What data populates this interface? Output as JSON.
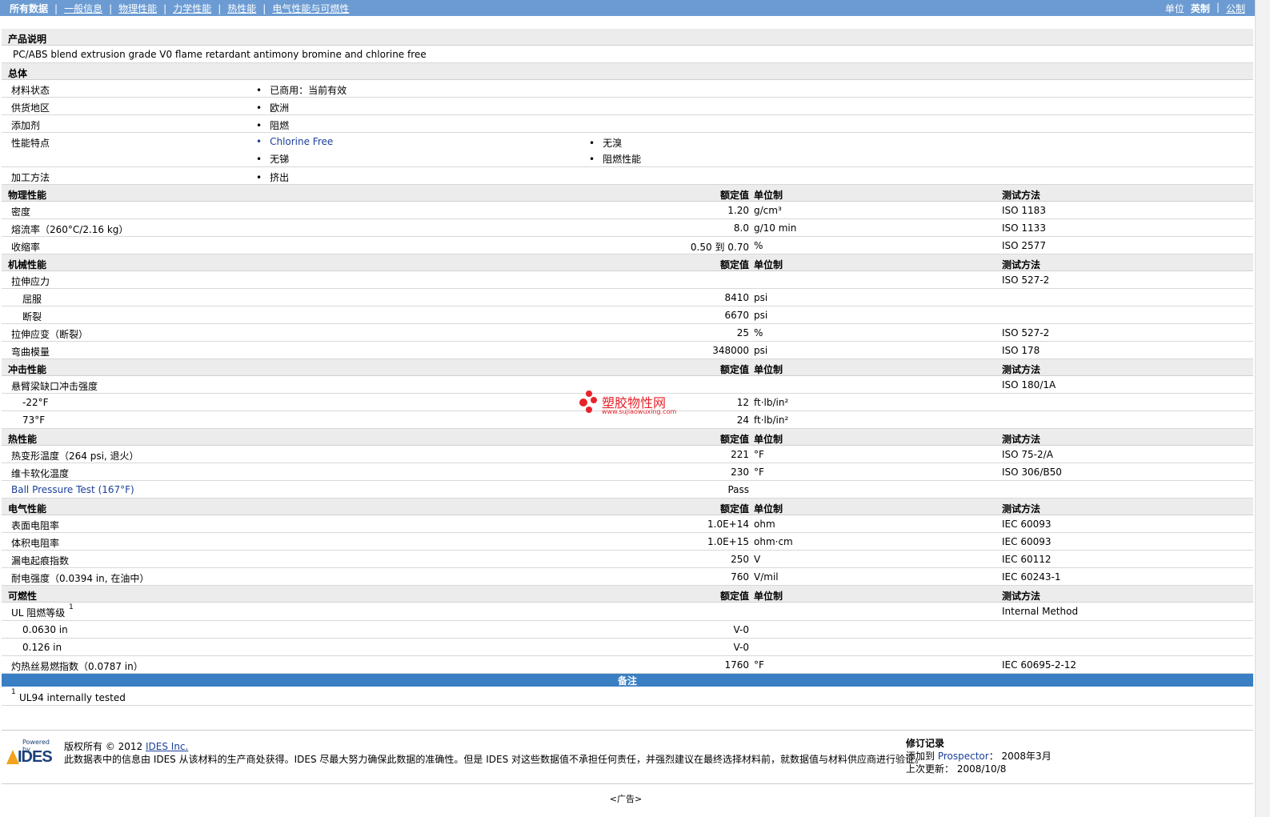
{
  "nav": {
    "items": [
      "所有数据",
      "一般信息",
      "物理性能",
      "力学性能",
      "热性能",
      "电气性能与可燃性"
    ],
    "units_label": "单位",
    "english": "英制",
    "metric": "公制"
  },
  "description": {
    "header": "产品说明",
    "text": "PC/ABS blend extrusion grade V0 flame retardant antimony bromine and chlorine free"
  },
  "general": {
    "header": "总体",
    "rows": [
      {
        "name": "材料状态",
        "items": [
          "已商用：当前有效"
        ]
      },
      {
        "name": "供货地区",
        "items": [
          "欧洲"
        ]
      },
      {
        "name": "添加剂",
        "items": [
          "阻燃"
        ]
      },
      {
        "name": "性能特点",
        "items": [
          "Chlorine Free",
          "无溴",
          "无锑",
          "阻燃性能"
        ]
      },
      {
        "name": "加工方法",
        "items": [
          "挤出"
        ]
      }
    ]
  },
  "col_headers": {
    "value": "额定值",
    "unit": "单位制",
    "test": "测试方法"
  },
  "physical": {
    "header": "物理性能",
    "rows": [
      {
        "name": "密度",
        "value": "1.20",
        "unit": "g/cm³",
        "test": "ISO 1183"
      },
      {
        "name": "熔流率（260°C/2.16 kg）",
        "value": "8.0",
        "unit": "g/10 min",
        "test": "ISO 1133"
      },
      {
        "name": "收缩率",
        "value": "0.50 到  0.70",
        "unit": "%",
        "test": "ISO 2577"
      }
    ]
  },
  "mechanical": {
    "header": "机械性能",
    "rows": [
      {
        "name": "拉伸应力",
        "value": "",
        "unit": "",
        "test": "ISO 527-2",
        "sub": false
      },
      {
        "name": "屈服",
        "value": "8410",
        "unit": "psi",
        "test": "",
        "sub": true
      },
      {
        "name": "断裂",
        "value": "6670",
        "unit": "psi",
        "test": "",
        "sub": true
      },
      {
        "name": "拉伸应变（断裂）",
        "value": "25",
        "unit": "%",
        "test": "ISO 527-2",
        "sub": false
      },
      {
        "name": "弯曲模量",
        "value": "348000",
        "unit": "psi",
        "test": "ISO 178",
        "sub": false
      }
    ]
  },
  "impact": {
    "header": "冲击性能",
    "rows": [
      {
        "name": "悬臂梁缺口冲击强度",
        "value": "",
        "unit": "",
        "test": "ISO 180/1A",
        "sub": false
      },
      {
        "name": "-22°F",
        "value": "12",
        "unit": "ft·lb/in²",
        "test": "",
        "sub": true
      },
      {
        "name": "73°F",
        "value": "24",
        "unit": "ft·lb/in²",
        "test": "",
        "sub": true
      }
    ]
  },
  "thermal": {
    "header": "热性能",
    "rows": [
      {
        "name": "热变形温度（264 psi, 退火）",
        "value": "221",
        "unit": "°F",
        "test": "ISO 75-2/A"
      },
      {
        "name": "维卡软化温度",
        "value": "230",
        "unit": "°F",
        "test": "ISO 306/B50"
      },
      {
        "name": "Ball Pressure Test (167°F)",
        "value": "Pass",
        "unit": "",
        "test": ""
      }
    ]
  },
  "electrical": {
    "header": "电气性能",
    "rows": [
      {
        "name": "表面电阻率",
        "value": "1.0E+14",
        "unit": "ohm",
        "test": "IEC 60093"
      },
      {
        "name": "体积电阻率",
        "value": "1.0E+15",
        "unit": "ohm·cm",
        "test": "IEC 60093"
      },
      {
        "name": "漏电起痕指数",
        "value": "250",
        "unit": "V",
        "test": "IEC 60112"
      },
      {
        "name": "耐电强度（0.0394 in, 在油中）",
        "value": "760",
        "unit": "V/mil",
        "test": "IEC 60243-1"
      }
    ]
  },
  "flammability": {
    "header": "可燃性",
    "rows": [
      {
        "name": "UL 阻燃等级",
        "sup": "1",
        "value": "",
        "unit": "",
        "test": "Internal Method",
        "sub": false
      },
      {
        "name": "0.0630 in",
        "value": "V-0",
        "unit": "",
        "test": "",
        "sub": true
      },
      {
        "name": "0.126 in",
        "value": "V-0",
        "unit": "",
        "test": "",
        "sub": true
      },
      {
        "name": "灼热丝易燃指数（0.0787 in）",
        "value": "1760",
        "unit": "°F",
        "test": "IEC 60695-2-12",
        "sub": false
      }
    ]
  },
  "notes": {
    "header": "备注",
    "items": [
      {
        "sup": "1",
        "text": "UL94 internally tested"
      }
    ]
  },
  "watermark": {
    "text": "塑胶物性网",
    "url": "www.sujiaowuxing.com"
  },
  "footer": {
    "powered": "Powered by",
    "logo": "IDES",
    "copyright_prefix": "版权所有 © 2012 ",
    "copyright_link": "IDES Inc.",
    "disclaimer": "此数据表中的信息由 IDES 从该材料的生产商处获得。IDES 尽最大努力确保此数据的准确性。但是 IDES 对这些数据值不承担任何责任，并强烈建议在最终选择材料前，就数据值与材料供应商进行验证。",
    "revision_header": "修订记录",
    "added_label": "添加到 ",
    "added_link": "Prospector",
    "added_value": "：  2008年3月",
    "updated_label": "上次更新：",
    "updated_value": "2008/10/8"
  },
  "ad": "<广告>"
}
